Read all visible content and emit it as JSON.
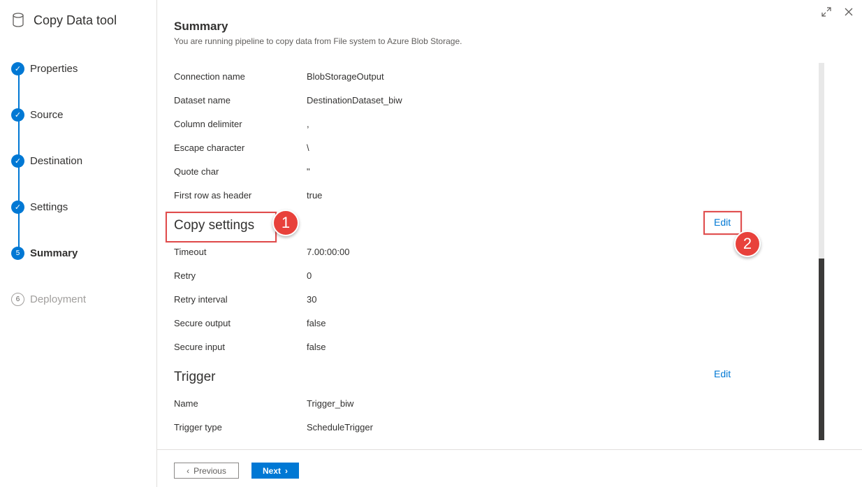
{
  "sidebar": {
    "title": "Copy Data tool",
    "steps": [
      {
        "label": "Properties",
        "state": "done",
        "marker": "✓"
      },
      {
        "label": "Source",
        "state": "done",
        "marker": "✓"
      },
      {
        "label": "Destination",
        "state": "done",
        "marker": "✓"
      },
      {
        "label": "Settings",
        "state": "done",
        "marker": "✓"
      },
      {
        "label": "Summary",
        "state": "active",
        "marker": "5"
      },
      {
        "label": "Deployment",
        "state": "pending",
        "marker": "6"
      }
    ]
  },
  "header": {
    "title": "Summary",
    "subtitle": "You are running pipeline to copy data from File system to Azure Blob Storage."
  },
  "destination_rows": [
    {
      "key": "Connection name",
      "value": "BlobStorageOutput"
    },
    {
      "key": "Dataset name",
      "value": "DestinationDataset_biw"
    },
    {
      "key": "Column delimiter",
      "value": ","
    },
    {
      "key": "Escape character",
      "value": "\\"
    },
    {
      "key": "Quote char",
      "value": "\""
    },
    {
      "key": "First row as header",
      "value": "true"
    }
  ],
  "copy_settings": {
    "title": "Copy settings",
    "edit_label": "Edit",
    "rows": [
      {
        "key": "Timeout",
        "value": "7.00:00:00"
      },
      {
        "key": "Retry",
        "value": "0"
      },
      {
        "key": "Retry interval",
        "value": "30"
      },
      {
        "key": "Secure output",
        "value": "false"
      },
      {
        "key": "Secure input",
        "value": "false"
      }
    ]
  },
  "trigger": {
    "title": "Trigger",
    "edit_label": "Edit",
    "rows": [
      {
        "key": "Name",
        "value": "Trigger_biw"
      },
      {
        "key": "Trigger type",
        "value": "ScheduleTrigger"
      }
    ]
  },
  "annotations": {
    "badge1": "1",
    "badge2": "2"
  },
  "footer": {
    "previous_label": "Previous",
    "next_label": "Next"
  },
  "colors": {
    "accent": "#0078d4",
    "annotation": "#e8413b"
  }
}
